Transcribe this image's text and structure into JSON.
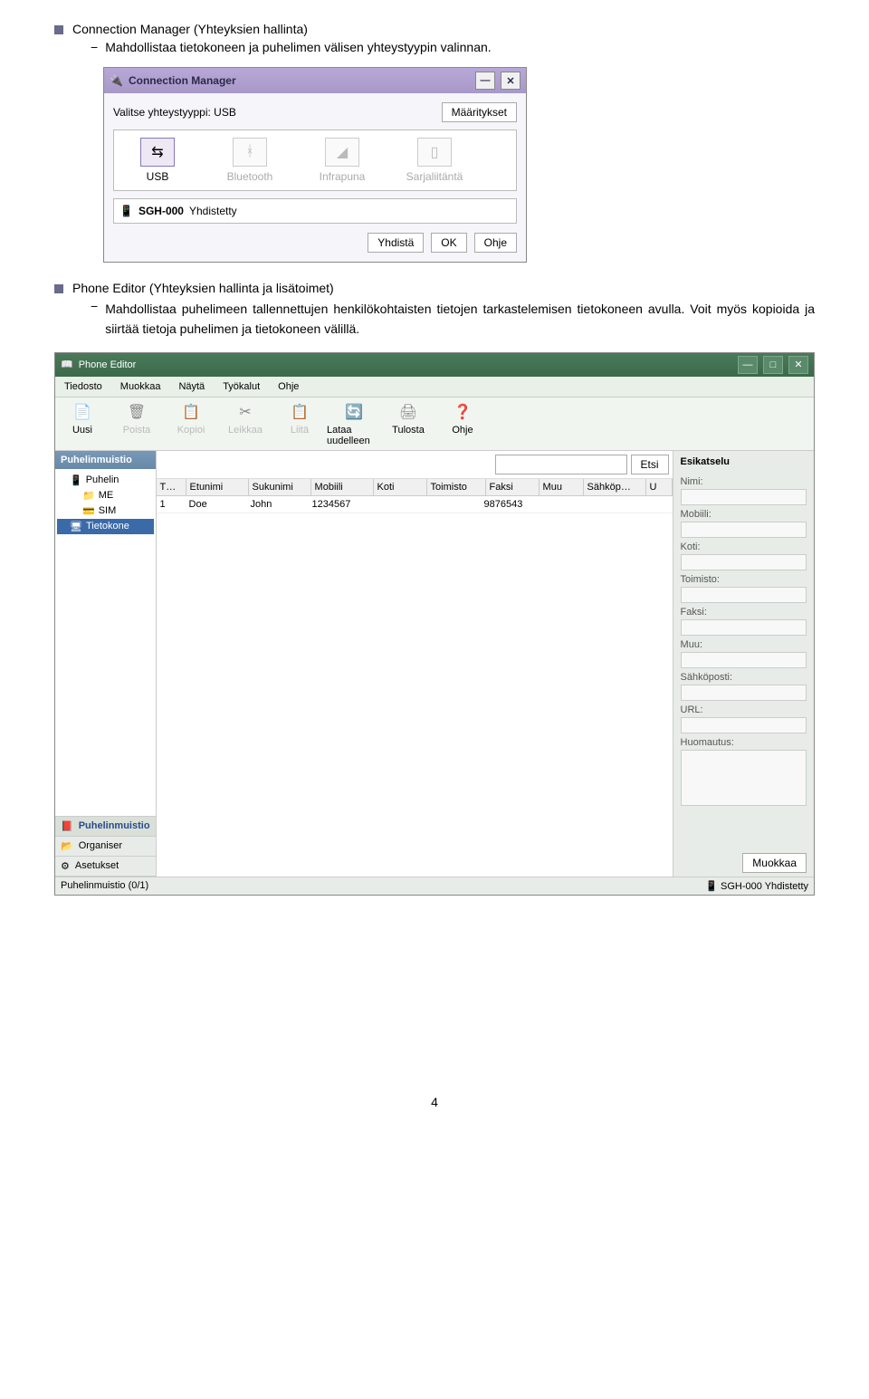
{
  "section1": {
    "title": "Connection Manager (Yhteyksien hallinta)",
    "desc": "Mahdollistaa tietokoneen ja puhelimen välisen yhteystyypin valinnan."
  },
  "cm": {
    "title": "Connection Manager",
    "label": "Valitse yhteystyyppi: USB",
    "settings": "Määritykset",
    "types": [
      "USB",
      "Bluetooth",
      "Infrapuna",
      "Sarjaliitäntä"
    ],
    "dev": "SGH-000",
    "devStatus": "Yhdistetty",
    "btnConnect": "Yhdistä",
    "btnOk": "OK",
    "btnHelp": "Ohje"
  },
  "section2": {
    "title": "Phone Editor (Yhteyksien hallinta ja lisätoimet)",
    "desc": "Mahdollistaa puhelimeen tallennettujen henkilökohtaisten tietojen tarkastelemisen tietokoneen avulla. Voit myös kopioida ja siirtää tietoja puhelimen ja tietokoneen välillä."
  },
  "pe": {
    "title": "Phone Editor",
    "menu": [
      "Tiedosto",
      "Muokkaa",
      "Näytä",
      "Työkalut",
      "Ohje"
    ],
    "tools": [
      "Uusi",
      "Poista",
      "Kopioi",
      "Leikkaa",
      "Liitä",
      "Lataa uudelleen",
      "Tulosta",
      "Ohje"
    ],
    "leftHdr": "Puhelinmuistio",
    "tree": {
      "root": "Puhelin",
      "me": "ME",
      "sim": "SIM",
      "pc": "Tietokone"
    },
    "leftBtm": [
      "Puhelinmuistio",
      "Organiser",
      "Asetukset"
    ],
    "search": "Etsi",
    "cols": [
      "T…",
      "Etunimi",
      "Sukunimi",
      "Mobiili",
      "Koti",
      "Toimisto",
      "Faksi",
      "Muu",
      "Sähköp…",
      "U"
    ],
    "row": {
      "n": "1",
      "fn": "Doe",
      "ln": "John",
      "mob": "1234567",
      "fax": "9876543"
    },
    "preview": {
      "hdr": "Esikatselu",
      "f": [
        "Nimi:",
        "Mobiili:",
        "Koti:",
        "Toimisto:",
        "Faksi:",
        "Muu:",
        "Sähköposti:",
        "URL:",
        "Huomautus:"
      ],
      "edit": "Muokkaa"
    },
    "statusL": "Puhelinmuistio (0/1)",
    "statusR": "SGH-000 Yhdistetty"
  },
  "page": "4"
}
